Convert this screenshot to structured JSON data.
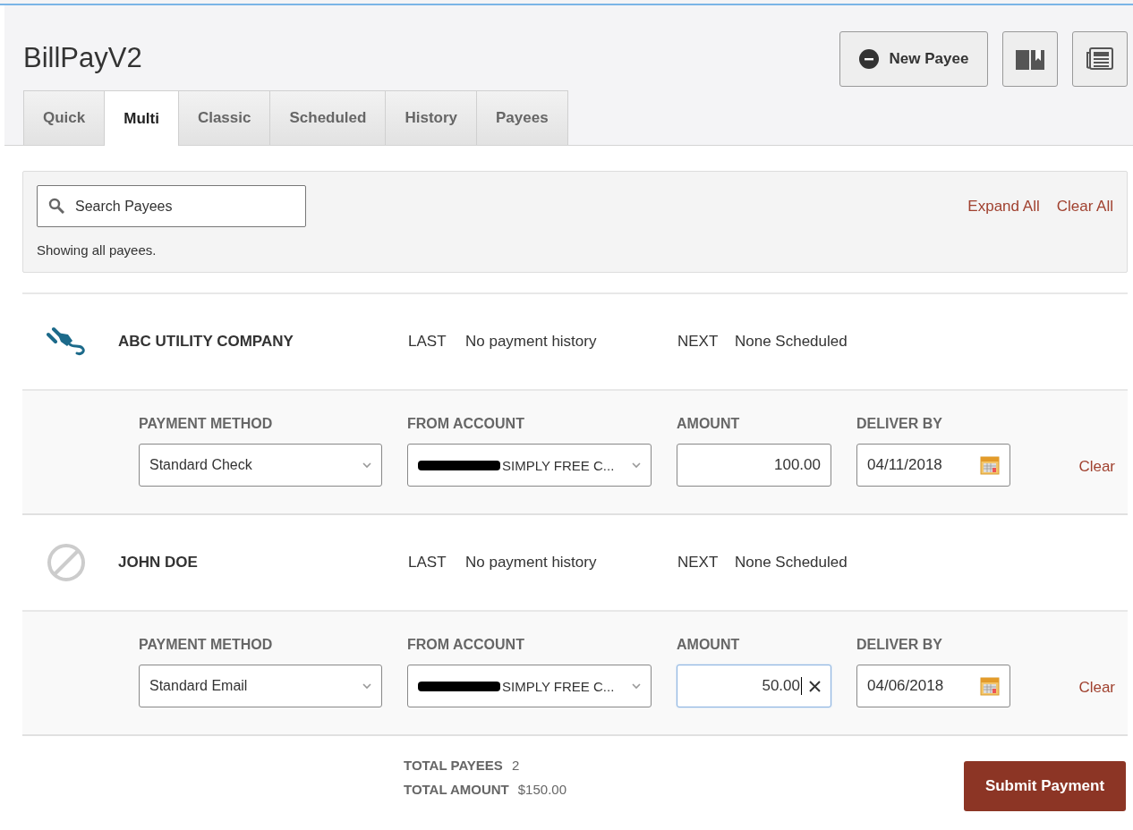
{
  "header": {
    "title": "BillPayV2",
    "new_payee_button": "New Payee"
  },
  "tabs": [
    {
      "label": "Quick",
      "selected": false
    },
    {
      "label": "Multi",
      "selected": true
    },
    {
      "label": "Classic",
      "selected": false
    },
    {
      "label": "Scheduled",
      "selected": false
    },
    {
      "label": "History",
      "selected": false
    },
    {
      "label": "Payees",
      "selected": false
    }
  ],
  "search": {
    "placeholder": "Search Payees",
    "status": "Showing all payees.",
    "expand_all": "Expand All",
    "clear_all": "Clear All"
  },
  "payees": [
    {
      "name": "ABC UTILITY COMPANY",
      "kind": "utility",
      "last_label": "LAST",
      "last": "No payment history",
      "next_label": "NEXT",
      "next": "None Scheduled",
      "method_label": "PAYMENT METHOD",
      "method": "Standard Check",
      "account_label": "FROM ACCOUNT",
      "account_redacted": true,
      "account": "SIMPLY FREE C...",
      "amount_label": "AMOUNT",
      "amount": "100.00",
      "amount_focused": false,
      "deliver_label": "DELIVER BY",
      "deliver_by": "04/11/2018",
      "clear": "Clear"
    },
    {
      "name": "JOHN DOE",
      "kind": "person",
      "last_label": "LAST",
      "last": "No payment history",
      "next_label": "NEXT",
      "next": "None Scheduled",
      "method_label": "PAYMENT METHOD",
      "method": "Standard Email",
      "account_label": "FROM ACCOUNT",
      "account_redacted": true,
      "account": "SIMPLY FREE C...",
      "amount_label": "AMOUNT",
      "amount": "50.00",
      "amount_focused": true,
      "deliver_label": "DELIVER BY",
      "deliver_by": "04/06/2018",
      "clear": "Clear"
    }
  ],
  "totals": {
    "payees_label": "TOTAL PAYEES",
    "payees": "2",
    "amount_label": "TOTAL AMOUNT",
    "amount": "$150.00"
  },
  "submit_button": "Submit Payment"
}
